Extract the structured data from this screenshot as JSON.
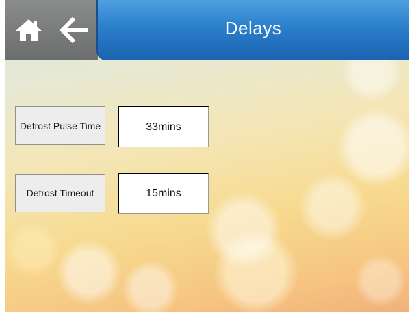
{
  "header": {
    "title": "Delays",
    "home_icon": "home-icon",
    "back_icon": "arrow-left-icon",
    "accent_color": "#2a7fcb"
  },
  "settings": [
    {
      "label": "Defrost Pulse Time",
      "value": "33mins"
    },
    {
      "label": "Defrost Timeout",
      "value": "15mins"
    }
  ]
}
